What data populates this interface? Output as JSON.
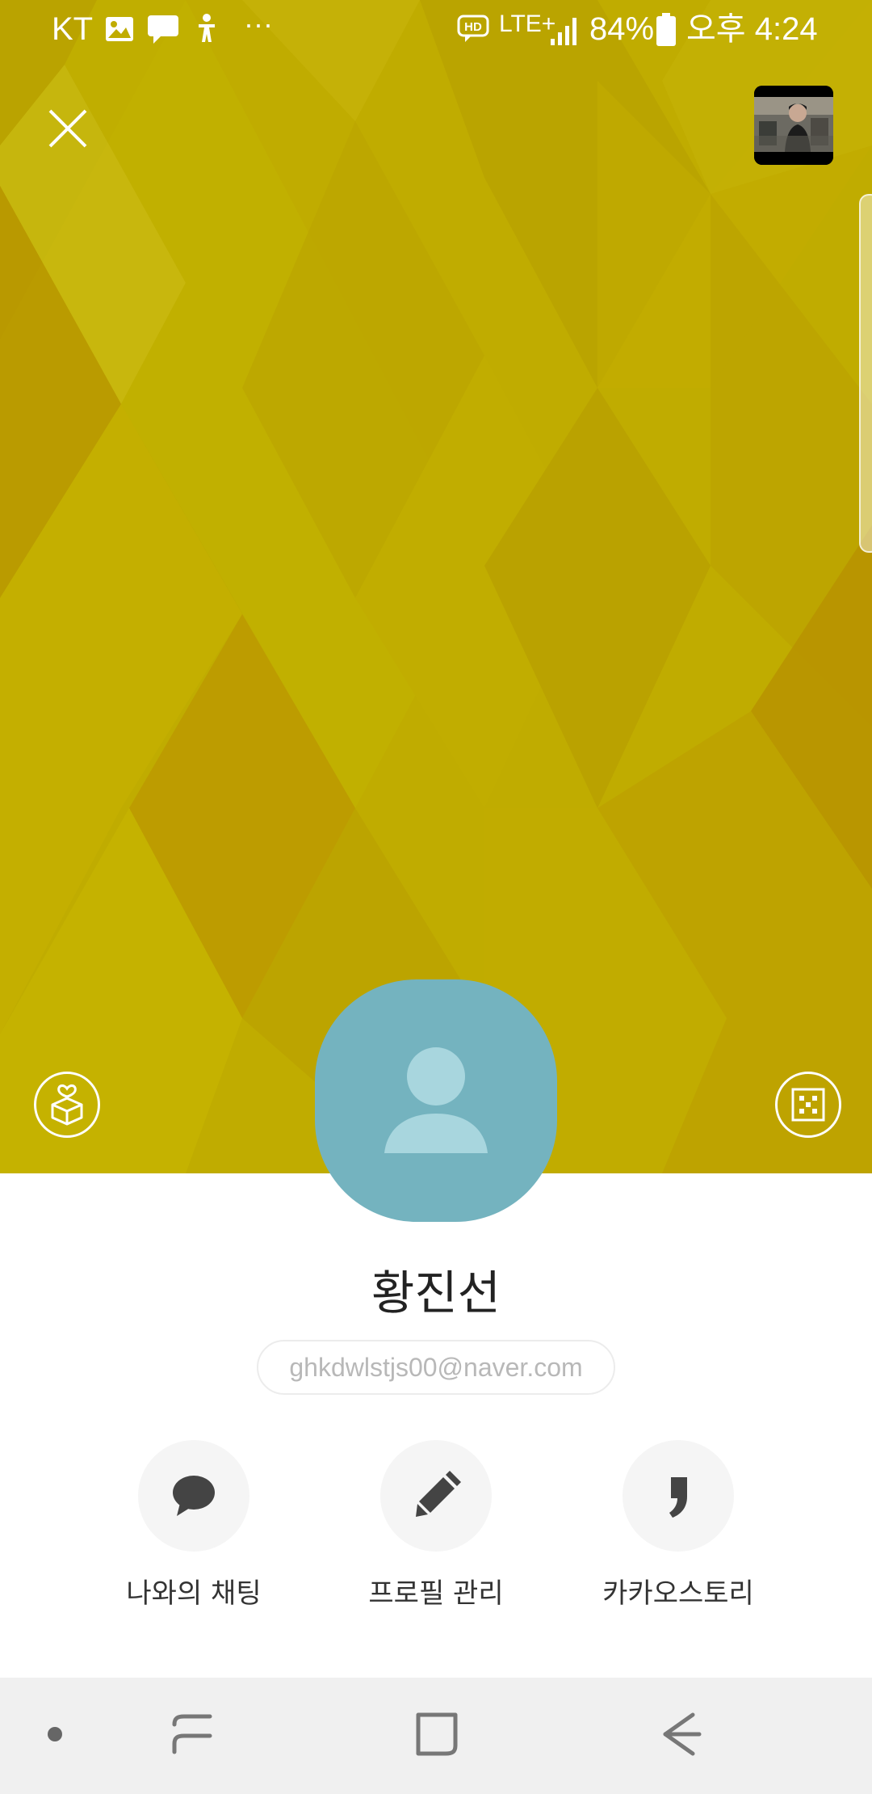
{
  "status_bar": {
    "carrier": "KT",
    "more": "···",
    "hd": "HD",
    "network": "LTE+",
    "battery": "84%",
    "time": "오후 4:24"
  },
  "colors": {
    "cover_background": "#c0ac00",
    "avatar_background": "#74b3bf",
    "action_circle": "#f5f5f5",
    "nav_bar": "#f0f0f0"
  },
  "header": {
    "close_icon": "close-icon",
    "thumbnail": "profile-thumbnail-image"
  },
  "cover": {
    "gift_icon": "gift-box-icon",
    "qr_icon": "qr-code-icon"
  },
  "profile": {
    "name": "황진선",
    "email": "ghkdwlstjs00@naver.com"
  },
  "actions": [
    {
      "label": "나와의 채팅",
      "icon": "chat-bubble-icon"
    },
    {
      "label": "프로필 관리",
      "icon": "pencil-icon"
    },
    {
      "label": "카카오스토리",
      "icon": "quote-mark-icon"
    }
  ],
  "nav_bar": {
    "items": [
      "dot-icon",
      "recent-apps-icon",
      "home-icon",
      "back-icon"
    ]
  }
}
